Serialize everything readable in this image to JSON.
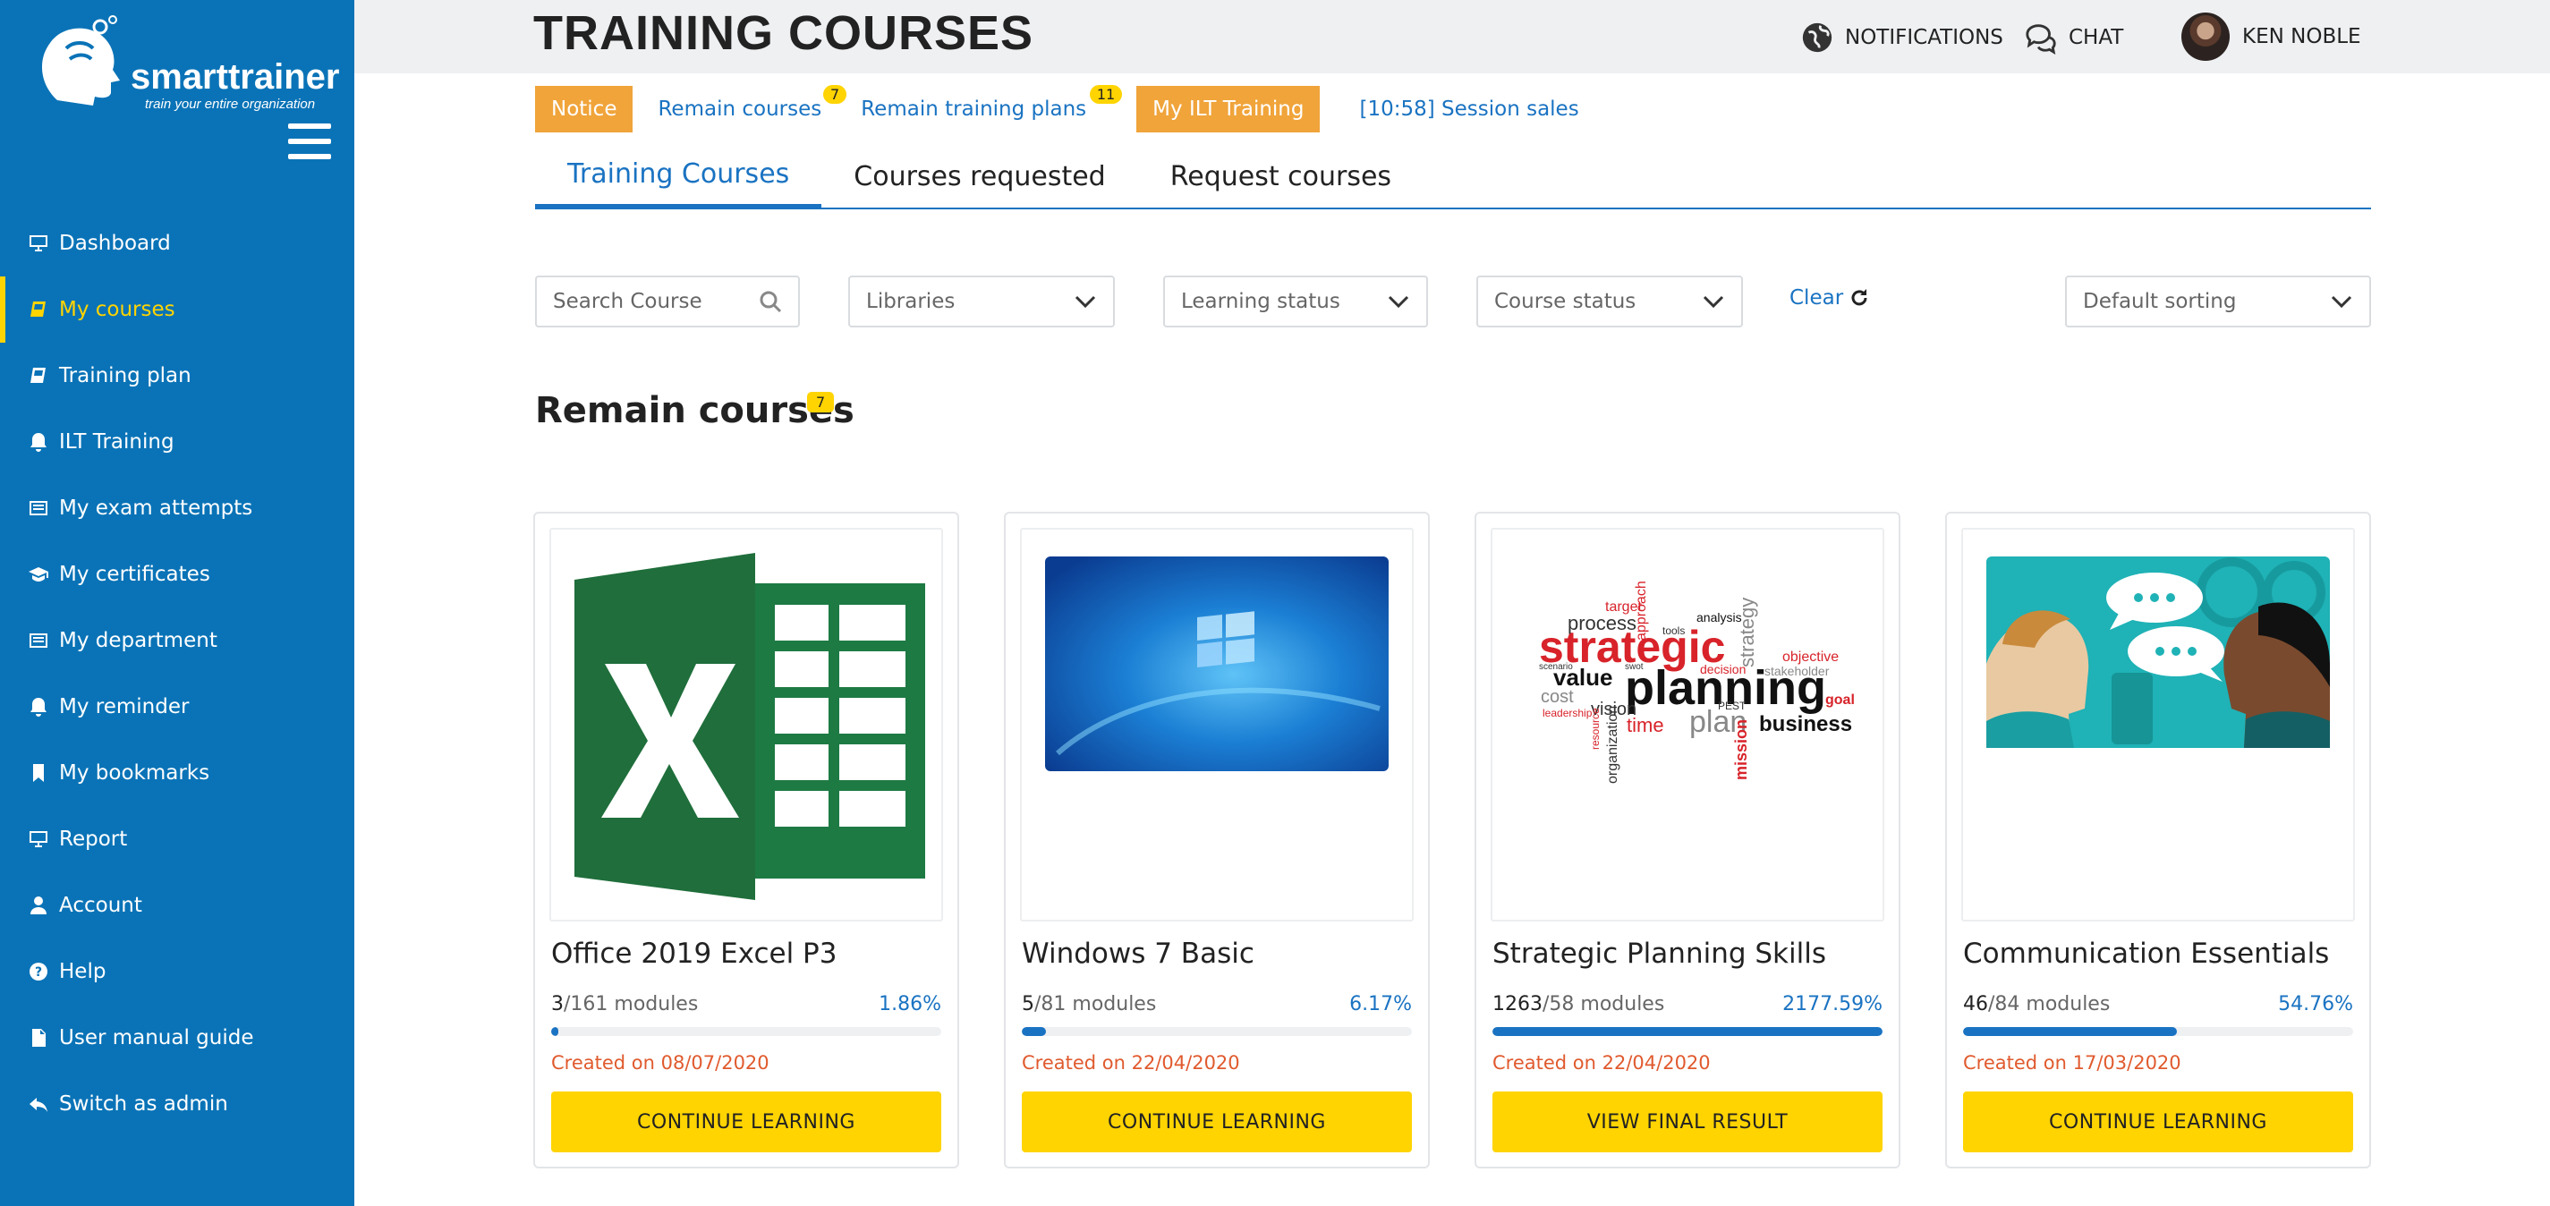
{
  "app": {
    "logo_text": "smarttrainer",
    "logo_tagline": "train your entire organization"
  },
  "sidebar": {
    "items": [
      {
        "label": "Dashboard",
        "icon": "monitor-icon"
      },
      {
        "label": "My courses",
        "icon": "book-icon",
        "active": true
      },
      {
        "label": "Training plan",
        "icon": "book-icon"
      },
      {
        "label": "ILT Training",
        "icon": "bell-icon"
      },
      {
        "label": "My exam attempts",
        "icon": "list-icon"
      },
      {
        "label": "My certificates",
        "icon": "graduation-cap-icon"
      },
      {
        "label": "My department",
        "icon": "list-icon"
      },
      {
        "label": "My reminder",
        "icon": "bell-icon"
      },
      {
        "label": "My bookmarks",
        "icon": "bookmark-icon"
      },
      {
        "label": "Report",
        "icon": "monitor-icon"
      },
      {
        "label": "Account",
        "icon": "user-icon"
      },
      {
        "label": "Help",
        "icon": "question-circle-icon"
      },
      {
        "label": "User manual guide",
        "icon": "file-icon"
      },
      {
        "label": "Switch as admin",
        "icon": "reply-icon"
      }
    ]
  },
  "header": {
    "title": "TRAINING COURSES",
    "notifications_label": "NOTIFICATIONS",
    "chat_label": "CHAT",
    "user_name": "KEN NOBLE"
  },
  "notices": {
    "notice_label": "Notice",
    "remain_courses_label": "Remain courses",
    "remain_courses_count": "7",
    "remain_plans_label": "Remain training plans",
    "remain_plans_count": "11",
    "ilt_label": "My ILT Training",
    "session_label": "[10:58] Session sales"
  },
  "tabs": [
    {
      "label": "Training Courses",
      "active": true
    },
    {
      "label": "Courses requested"
    },
    {
      "label": "Request courses"
    }
  ],
  "filters": {
    "search_placeholder": "Search Course",
    "libraries": "Libraries",
    "learning_status": "Learning status",
    "course_status": "Course status",
    "clear_label": "Clear",
    "sorting": "Default sorting"
  },
  "section": {
    "title": "Remain courses",
    "count": "7"
  },
  "courses": [
    {
      "title": "Office 2019 Excel P3",
      "done": "3",
      "total": "/161 modules",
      "percent": "1.86%",
      "progress": 0.0186,
      "created": "Created on 08/07/2020",
      "button": "CONTINUE LEARNING"
    },
    {
      "title": "Windows 7 Basic",
      "done": "5",
      "total": "/81 modules",
      "percent": "6.17%",
      "progress": 0.0617,
      "created": "Created on 22/04/2020",
      "button": "CONTINUE LEARNING"
    },
    {
      "title": "Strategic Planning Skills",
      "done": "1263",
      "total": "/58 modules",
      "percent": "2177.59%",
      "progress": 1.0,
      "created": "Created on 22/04/2020",
      "button": "VIEW FINAL RESULT"
    },
    {
      "title": "Communication Essentials",
      "done": "46",
      "total": "/84 modules",
      "percent": "54.76%",
      "progress": 0.5476,
      "created": "Created on 17/03/2020",
      "button": "CONTINUE LEARNING"
    }
  ],
  "wordcloud": {
    "w1": "strategic",
    "w2": "planning",
    "w3": "plan",
    "w4": "business",
    "w5": "value",
    "w6": "process",
    "w7": "target",
    "w8": "approach",
    "w9": "analysis",
    "w10": "tools",
    "w11": "strategy",
    "w12": "objective",
    "w13": "stakeholder",
    "w14": "decision",
    "w15": "goal",
    "w16": "cost",
    "w17": "leadership",
    "w18": "vision",
    "w19": "time",
    "w20": "organization",
    "w21": "mission",
    "w22": "resource",
    "w23": "PEST",
    "w24": "scenario",
    "w25": "swot"
  },
  "colors": {
    "sidebar": "#0a73b7",
    "accent": "#1a73c2",
    "highlight": "#ffd400",
    "notice": "#f0a43a",
    "created": "#e05a2e"
  }
}
